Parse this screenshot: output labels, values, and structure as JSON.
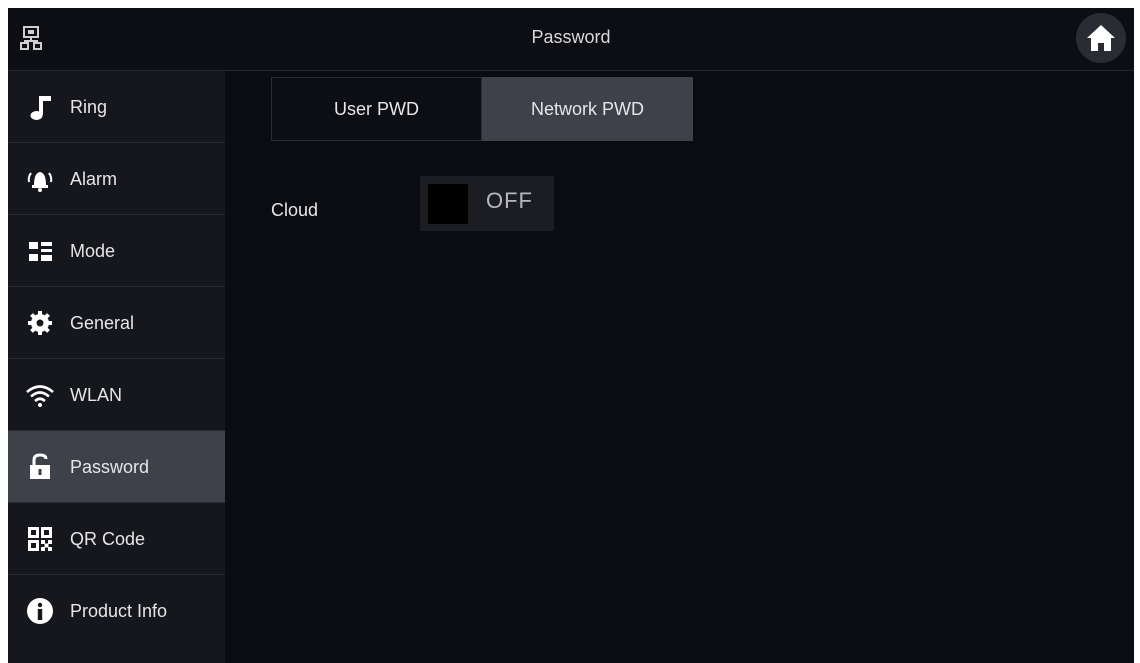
{
  "header": {
    "title": "Password",
    "left_icon": "network-icon",
    "home_icon": "home-icon"
  },
  "sidebar": {
    "items": [
      {
        "label": "Ring",
        "icon": "music-note-icon",
        "active": false
      },
      {
        "label": "Alarm",
        "icon": "alarm-bell-icon",
        "active": false
      },
      {
        "label": "Mode",
        "icon": "mode-grid-icon",
        "active": false
      },
      {
        "label": "General",
        "icon": "gear-icon",
        "active": false
      },
      {
        "label": "WLAN",
        "icon": "wifi-icon",
        "active": false
      },
      {
        "label": "Password",
        "icon": "unlock-icon",
        "active": true
      },
      {
        "label": "QR Code",
        "icon": "qr-code-icon",
        "active": false
      },
      {
        "label": "Product Info",
        "icon": "info-icon",
        "active": false
      }
    ]
  },
  "tabs": {
    "user": "User PWD",
    "network": "Network PWD",
    "selected": "Network PWD"
  },
  "cloud": {
    "label": "Cloud",
    "state": "OFF"
  },
  "colors": {
    "background": "#0b0c11",
    "sidebar": "#16171c",
    "active": "#3e414a",
    "text": "#e6e6e6"
  }
}
